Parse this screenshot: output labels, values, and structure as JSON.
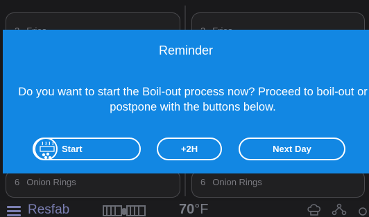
{
  "panels": {
    "top_left": {
      "number": "2",
      "name": "Fries"
    },
    "top_right": {
      "number": "2",
      "name": "Fries"
    },
    "bottom_left": {
      "number": "6",
      "name": "Onion Rings"
    },
    "bottom_right": {
      "number": "6",
      "name": "Onion Rings"
    }
  },
  "statusbar": {
    "brand": "Resfab",
    "temperature": "70",
    "temperature_unit": "°F",
    "icons": [
      "menu-icon",
      "fryer-vats-icon",
      "chef-hat-icon",
      "network-icon"
    ]
  },
  "modal": {
    "title": "Reminder",
    "message": "Do you want to start the Boil-out process now? Proceed to boil-out or postpone with the buttons below.",
    "buttons": {
      "start": "Start",
      "plus_2h": "+2H",
      "next_day": "Next Day"
    }
  },
  "colors": {
    "modal_background": "#1287e3",
    "brand": "#7b7fb2",
    "screen_background": "#19191b"
  }
}
